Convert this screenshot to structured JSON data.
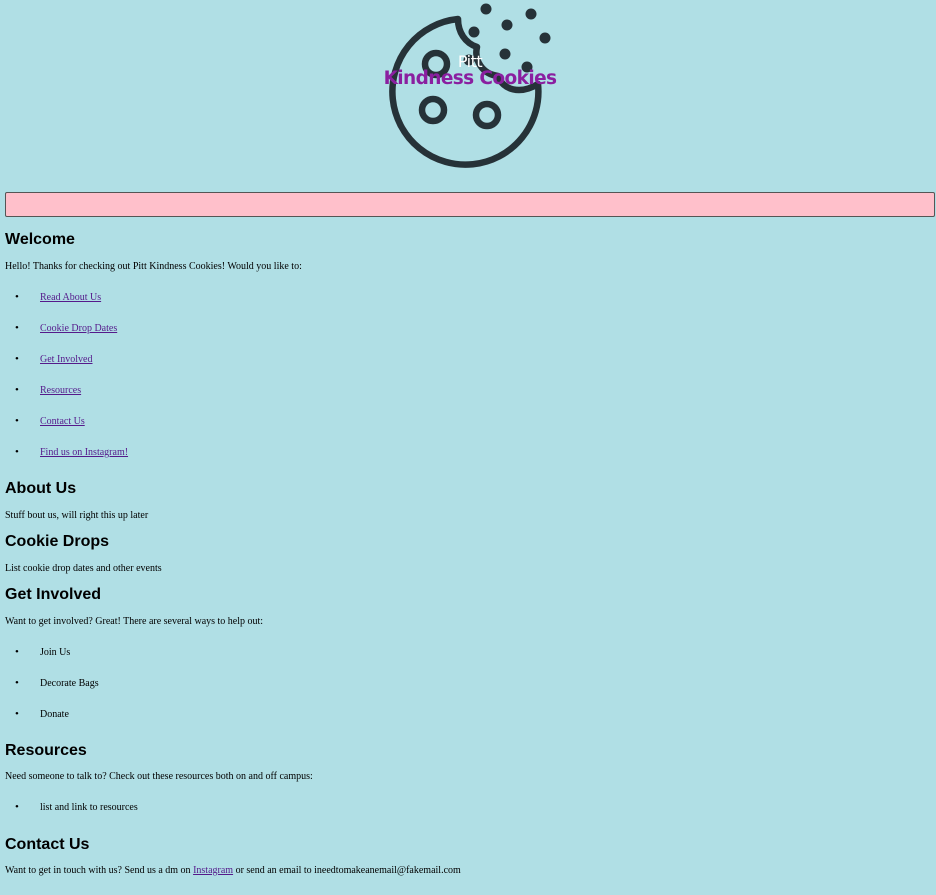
{
  "header": {
    "logo_small": "Pitt",
    "logo_name": "Kindness Cookies"
  },
  "welcome": {
    "heading": "Welcome",
    "intro": "Hello! Thanks for checking out Pitt Kindness Cookies! Would you like to:",
    "links": [
      "Read About Us",
      "Cookie Drop Dates",
      "Get Involved",
      "Resources",
      "Contact Us",
      "Find us on Instagram!"
    ]
  },
  "about": {
    "heading": "About Us",
    "text": "Stuff bout us, will right this up later"
  },
  "cookie_drops": {
    "heading": "Cookie Drops",
    "text": "List cookie drop dates and other events"
  },
  "get_involved": {
    "heading": "Get Involved",
    "text": "Want to get involved? Great! There are several ways to help out:",
    "items": [
      "Join Us",
      "Decorate Bags",
      "Donate"
    ]
  },
  "resources": {
    "heading": "Resources",
    "text": "Need someone to talk to? Check out these resources both on and off campus:",
    "items": [
      "list and link to resources"
    ]
  },
  "contact": {
    "heading": "Contact Us",
    "text_before": "Want to get in touch with us? Send us a dm on ",
    "link": "Instagram",
    "text_after": " or send an email to ineedtomakeanemail@fakemail.com"
  },
  "colors": {
    "background": "#b0dfe5",
    "nav_bar": "#ffc0cb",
    "logo_text": "#8a1fa0",
    "logo_line": "#263238"
  },
  "icons": [
    "cookie-logo-icon"
  ]
}
